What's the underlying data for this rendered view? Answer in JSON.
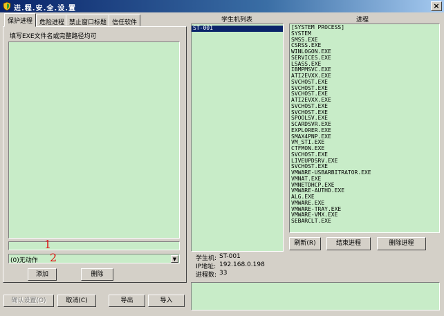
{
  "window": {
    "title": "进.程.安.全.设.置",
    "close_label": "×",
    "accent": "#0a246a",
    "field_bg": "#c8ecc8"
  },
  "tabs": [
    "保护进程",
    "危险进程",
    "禁止窗口标题",
    "信任软件"
  ],
  "protect": {
    "hint": "填写EXE文件名或完整路径均可",
    "input_value": "",
    "marker1": "1",
    "marker2": "2",
    "action_selected": "(0)无动作",
    "add_label": "添加",
    "delete_label": "删除"
  },
  "bottom": {
    "confirm_label": "确认设置(O)",
    "cancel_label": "取消(C)",
    "export_label": "导出",
    "import_label": "导入"
  },
  "students": {
    "header": "学生机列表",
    "items": [
      "ST-001"
    ]
  },
  "processes": {
    "header": "进程",
    "items": [
      "[SYSTEM PROCESS]",
      "SYSTEM",
      "SMSS.EXE",
      "CSRSS.EXE",
      "WINLOGON.EXE",
      "SERVICES.EXE",
      "LSASS.EXE",
      "IBMPMSVC.EXE",
      "ATI2EVXX.EXE",
      "SVCHOST.EXE",
      "SVCHOST.EXE",
      "SVCHOST.EXE",
      "ATI2EVXX.EXE",
      "SVCHOST.EXE",
      "SVCHOST.EXE",
      "SPOOLSV.EXE",
      "SCARDSVR.EXE",
      "EXPLORER.EXE",
      "SMAX4PNP.EXE",
      "VM_STI.EXE",
      "CTFMON.EXE",
      "SVCHOST.EXE",
      "LIVEUPDSRV.EXE",
      "SVCHOST.EXE",
      "VMWARE-USBARBITRATOR.EXE",
      "VMNAT.EXE",
      "VMNETDHCP.EXE",
      "VMWARE-AUTHD.EXE",
      "ALG.EXE",
      "VMWARE.EXE",
      "VMWARE-TRAY.EXE",
      "VMWARE-VMX.EXE",
      "SEBARCLT.EXE"
    ],
    "refresh_label": "刷新(R)",
    "end_label": "结束进程",
    "delete_label": "删除进程"
  },
  "info": {
    "student_label": "学生机:",
    "student_value": "ST-001",
    "ip_label": "IP地址:",
    "ip_value": "192.168.0.198",
    "count_label": "进程数:",
    "count_value": "33"
  }
}
